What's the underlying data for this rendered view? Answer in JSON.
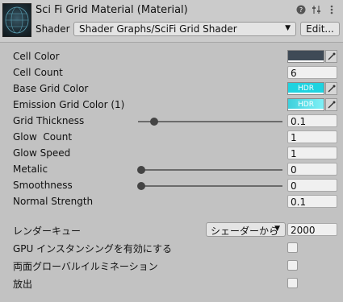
{
  "header": {
    "title": "Sci Fi Grid Material (Material)",
    "shader_label": "Shader",
    "shader_value": "Shader Graphs/SciFi Grid Shader",
    "edit_label": "Edit...",
    "icons": [
      "help-icon",
      "preset-icon",
      "more-icon"
    ]
  },
  "properties": {
    "cell_color": {
      "label": "Cell Color",
      "color": "#3f4a56"
    },
    "cell_count": {
      "label": "Cell Count",
      "value": "6"
    },
    "base_grid_color": {
      "label": "Base Grid Color",
      "color": "#1ed3e0",
      "badge": "HDR"
    },
    "emission_grid_color": {
      "label": "Emission Grid Color (1)",
      "color": "#4fe3ee",
      "badge": "HDR"
    },
    "grid_thickness": {
      "label": "Grid Thickness",
      "value": "0.1",
      "level": 0.1
    },
    "glow_count": {
      "label": "Glow  Count",
      "value": "1"
    },
    "glow_speed": {
      "label": "Glow Speed",
      "value": "1"
    },
    "metalic": {
      "label": "Metalic",
      "value": "0",
      "level": 0
    },
    "smoothness": {
      "label": "Smoothness",
      "value": "0",
      "level": 0
    },
    "normal_strength": {
      "label": "Normal Strength",
      "value": "0.1"
    }
  },
  "advanced": {
    "render_queue": {
      "label": "レンダーキュー",
      "mode": "シェーダーから",
      "value": "2000"
    },
    "gpu_instancing": {
      "label": "GPU インスタンシングを有効にする",
      "checked": false
    },
    "double_sided_gi": {
      "label": "両面グローバルイルミネーション",
      "checked": false
    },
    "emission": {
      "label": "放出",
      "checked": false
    }
  }
}
